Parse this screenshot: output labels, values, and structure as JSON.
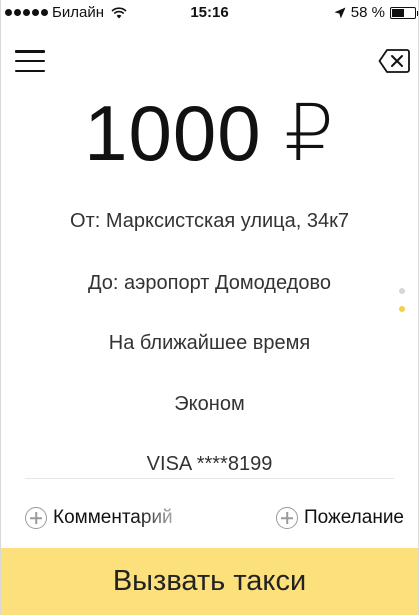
{
  "status_bar": {
    "carrier": "Билайн",
    "time": "15:16",
    "battery_percent": "58 %",
    "battery_level": 0.58
  },
  "header": {
    "menu_icon": "hamburger-menu-icon",
    "backspace_icon": "backspace-icon"
  },
  "order": {
    "price": "1000 ₽",
    "from": "От: Марксистская улица, 34к7",
    "to": "До: аэропорт Домодедово",
    "time": "На ближайшее время",
    "tariff": "Эконом",
    "payment": "VISA ****8199"
  },
  "options": {
    "comment_label": "Комментарий",
    "wish_label": "Пожелание"
  },
  "pager": {
    "pages": 2,
    "active_index": 1
  },
  "action": {
    "call_label": "Вызвать такси"
  },
  "colors": {
    "accent": "#fce07c",
    "active_dot": "#f5cf43"
  }
}
